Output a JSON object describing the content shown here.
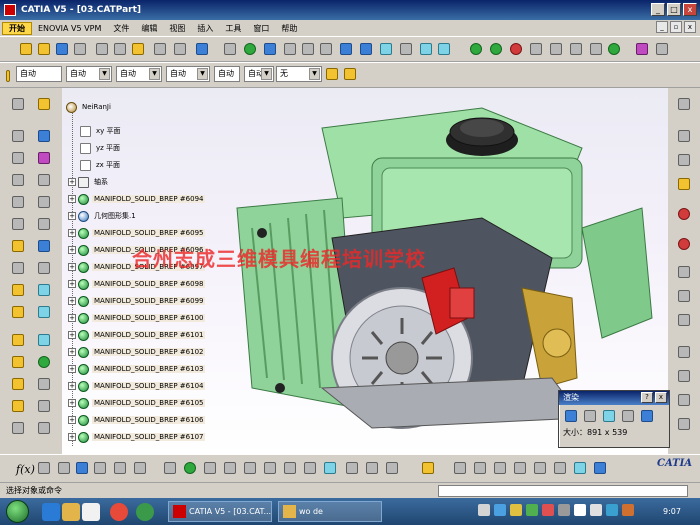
{
  "window": {
    "title": "CATIA V5 - [03.CATPart]"
  },
  "menu": [
    "开始",
    "ENOVIA V5 VPM",
    "文件",
    "编辑",
    "视图",
    "插入",
    "工具",
    "窗口",
    "帮助"
  ],
  "dropdowns": [
    "自动",
    "自动",
    "自动",
    "自动",
    "自动",
    "自动",
    "无"
  ],
  "tree": {
    "root": "NeiRanJi",
    "planes": [
      "xy 平面",
      "yz 平面",
      "zx 平面"
    ],
    "axis": "轴系",
    "manifold_first": "MANIFOLD_SOLID_BREP #6094",
    "geoset": "几何图形集.1",
    "manifolds": [
      "MANIFOLD_SOLID_BREP #6095",
      "MANIFOLD_SOLID_BREP #6096",
      "MANIFOLD_SOLID_BREP #6097",
      "MANIFOLD_SOLID_BREP #6098",
      "MANIFOLD_SOLID_BREP #6099",
      "MANIFOLD_SOLID_BREP #6100",
      "MANIFOLD_SOLID_BREP #6101",
      "MANIFOLD_SOLID_BREP #6102",
      "MANIFOLD_SOLID_BREP #6103",
      "MANIFOLD_SOLID_BREP #6104",
      "MANIFOLD_SOLID_BREP #6105",
      "MANIFOLD_SOLID_BREP #6106",
      "MANIFOLD_SOLID_BREP #6107"
    ]
  },
  "watermark": "合州志成三维模具编程培训学校",
  "render_dialog": {
    "title": "渲染",
    "size_label": "大小：891 x 539",
    "close": "x",
    "help": "?"
  },
  "statusbar": {
    "text": "选择对象或命令"
  },
  "taskbar": {
    "tasks": [
      "CATIA V5 - [03.CAT...",
      "wo de"
    ],
    "clock": "9:07"
  },
  "bottom": {
    "fx_label": "f(x)"
  },
  "logo": "CATIA",
  "colors": {
    "engine_green": "#8fd39a",
    "accent_red": "#d22020",
    "title_blue": "#0a246a"
  }
}
